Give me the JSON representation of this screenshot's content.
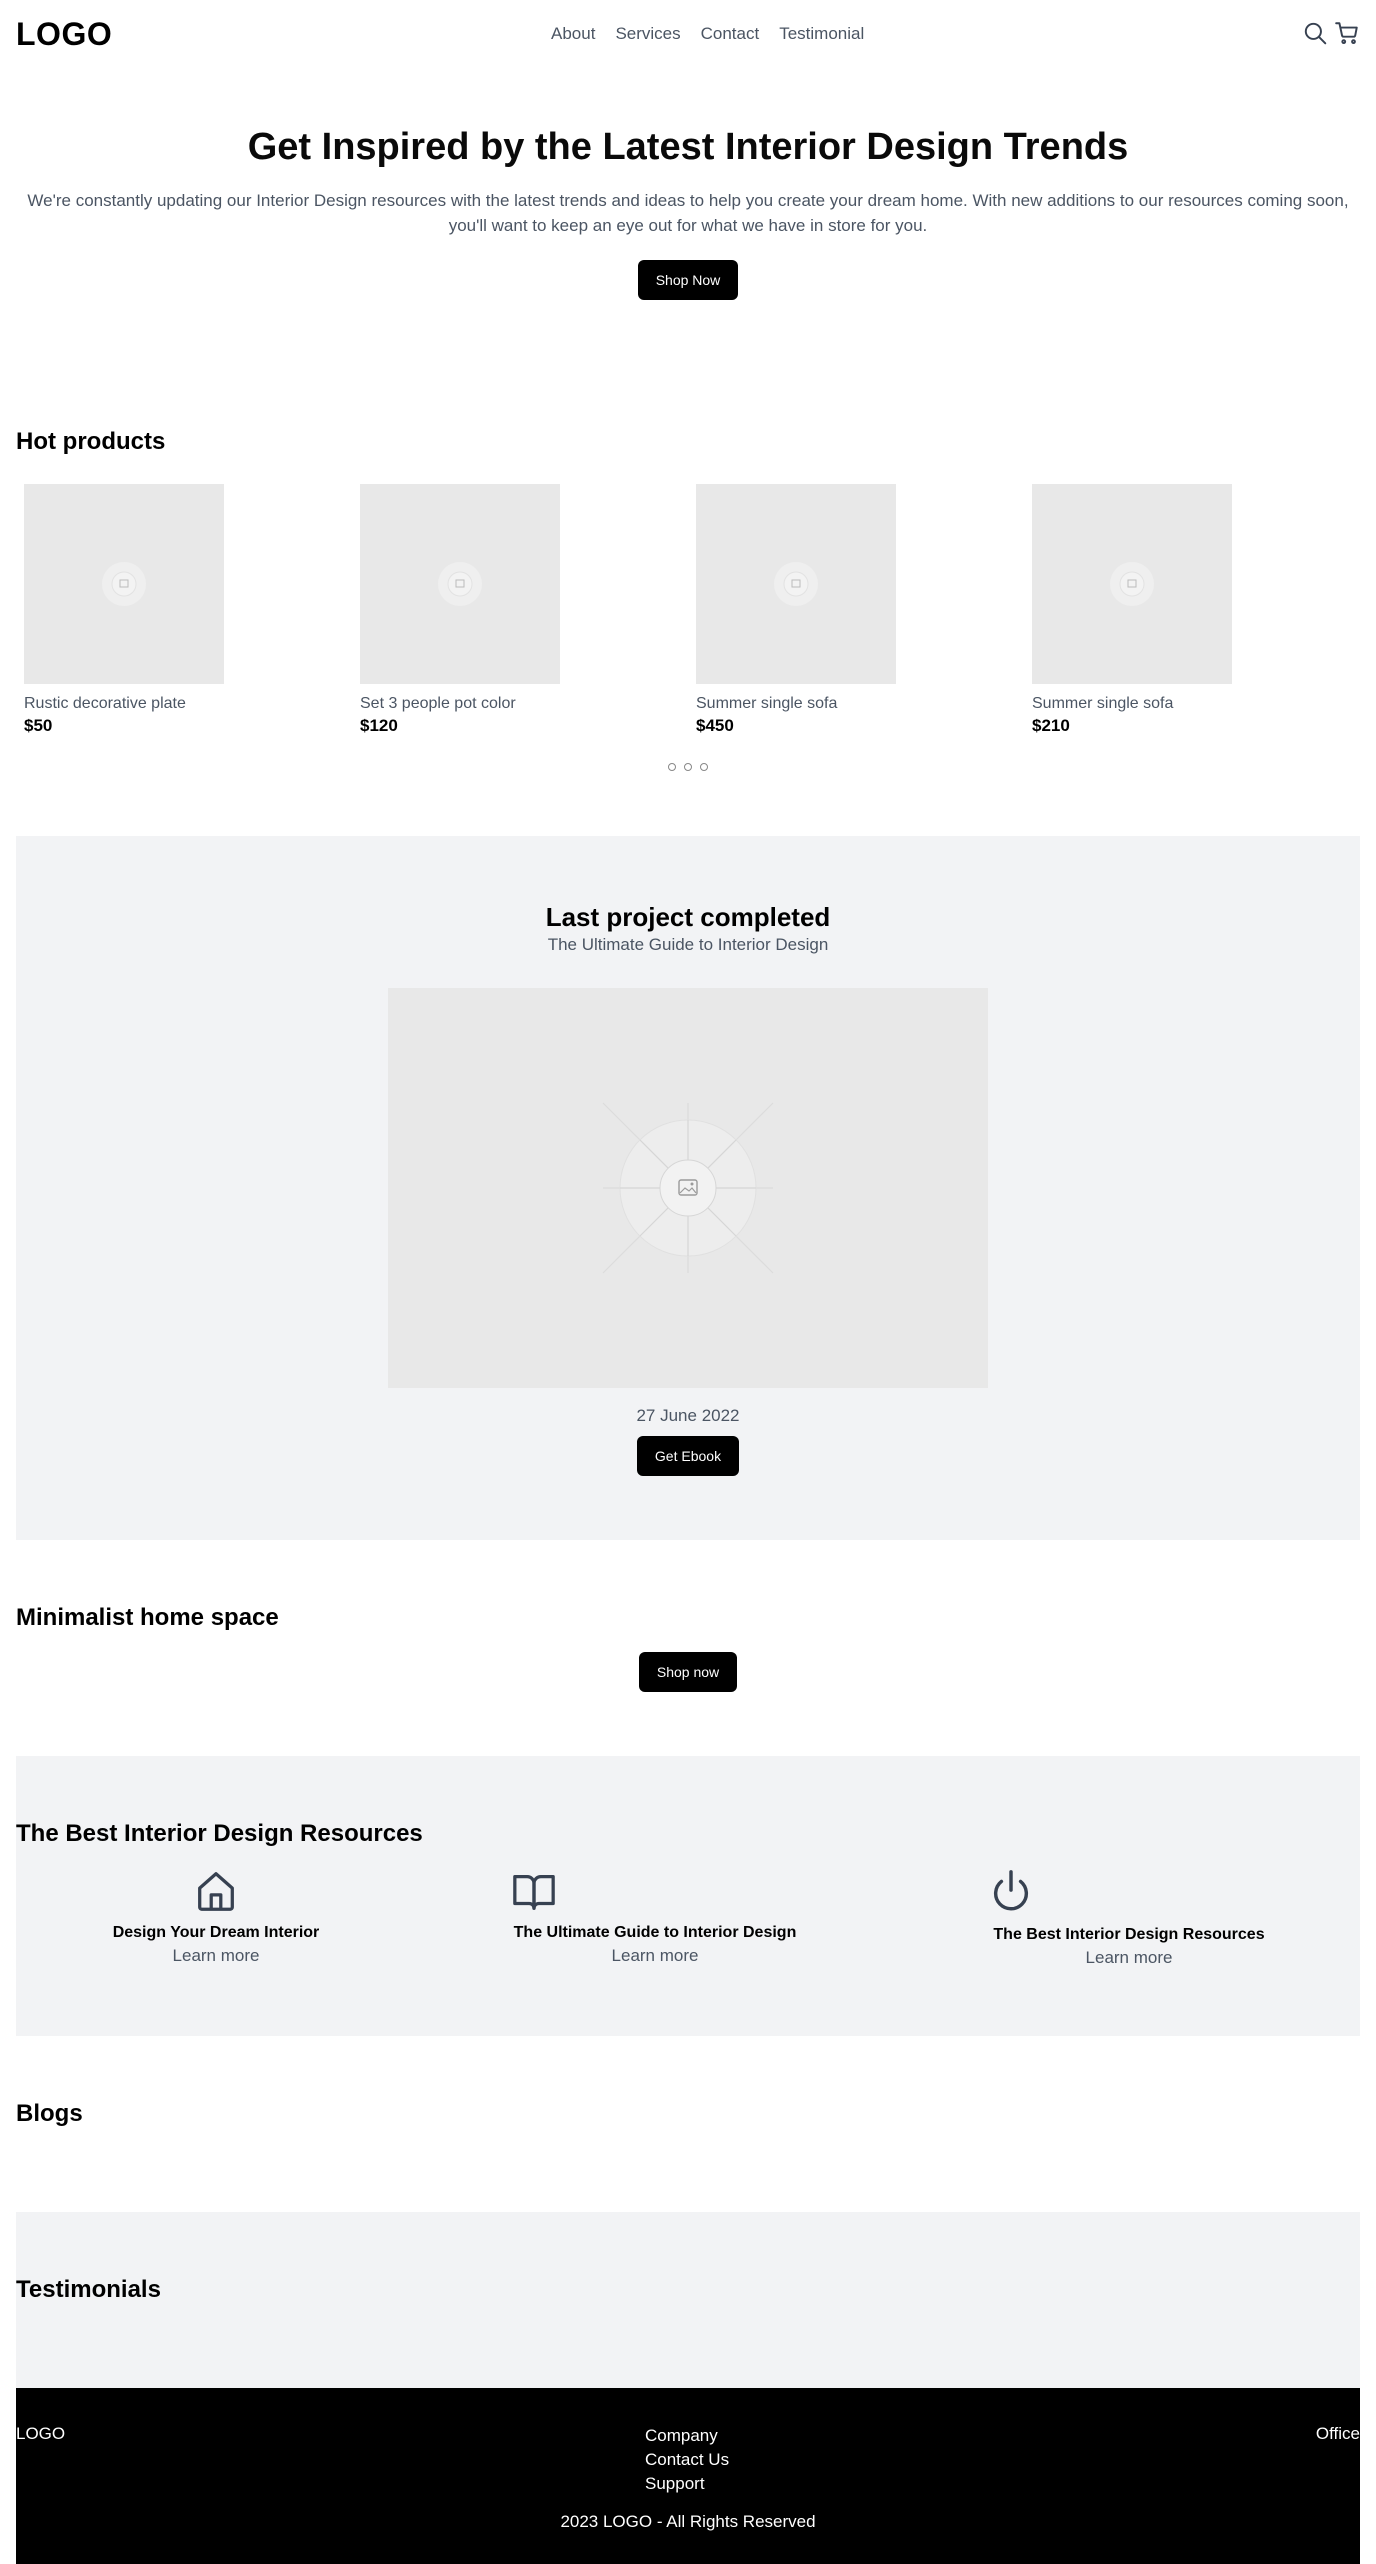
{
  "header": {
    "logo": "LOGO",
    "nav": [
      "About",
      "Services",
      "Contact",
      "Testimonial"
    ],
    "icons": [
      "search-icon",
      "cart-icon"
    ]
  },
  "hero": {
    "title": "Get Inspired by the Latest Interior Design Trends",
    "description": "We're constantly updating our Interior Design resources with the latest trends and ideas to help you create your dream home. With new additions to our resources coming soon, you'll want to keep an eye out for what we have in store for you.",
    "button": "Shop Now"
  },
  "hot_products": {
    "title": "Hot products",
    "items": [
      {
        "name": "Rustic decorative plate",
        "price": "$50"
      },
      {
        "name": "Set 3 people pot color",
        "price": "$120"
      },
      {
        "name": "Summer single sofa",
        "price": "$450"
      },
      {
        "name": "Summer single sofa",
        "price": "$210"
      }
    ],
    "carousel_pages": 3
  },
  "last_project": {
    "title": "Last project completed",
    "subtitle": "The Ultimate Guide to Interior Design",
    "date": "27 June 2022",
    "button": "Get Ebook"
  },
  "minimalist": {
    "title": "Minimalist home space",
    "button": "Shop now"
  },
  "resources": {
    "title": "The Best Interior Design Resources",
    "items": [
      {
        "icon": "home-icon",
        "title": "Design Your Dream Interior",
        "link": "Learn more"
      },
      {
        "icon": "book-icon",
        "title": "The Ultimate Guide to Interior Design",
        "link": "Learn more"
      },
      {
        "icon": "power-icon",
        "title": "The Best Interior Design Resources",
        "link": "Learn more"
      }
    ]
  },
  "blogs": {
    "title": "Blogs"
  },
  "testimonials": {
    "title": "Testimonials"
  },
  "footer": {
    "logo": "LOGO",
    "links": [
      "Company",
      "Contact Us",
      "Support"
    ],
    "office": "Office",
    "copyright": "2023 LOGO - All Rights Reserved"
  },
  "colors": {
    "text_muted": "#4b5563",
    "section_gray": "#f2f3f5",
    "placeholder": "#e8e8e8",
    "button_bg": "#000000",
    "footer_bg": "#000000"
  }
}
